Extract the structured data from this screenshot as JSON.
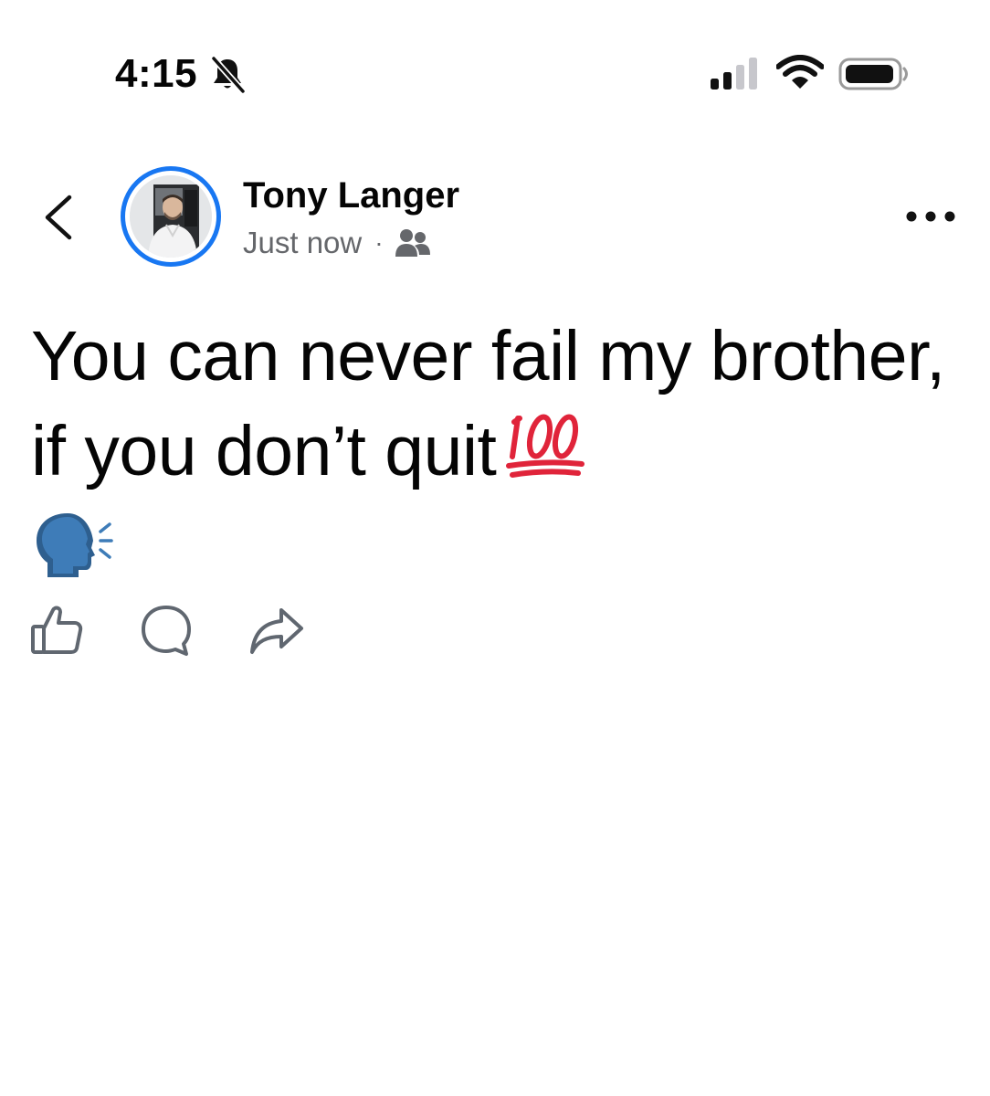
{
  "status_bar": {
    "time": "4:15",
    "icons": [
      "bell-slash-icon",
      "cellular-signal-icon",
      "wifi-icon",
      "battery-icon"
    ]
  },
  "header": {
    "back_icon": "chevron-left-icon",
    "author_name": "Tony Langer",
    "timestamp": "Just now",
    "separator": "·",
    "audience_icon": "friends-icon",
    "more_icon": "more-horizontal-icon",
    "avatar_ring_color": "#1877f2"
  },
  "post": {
    "text": "You can never fail my brother, if you don’t quit",
    "emojis": [
      "hundred-points-emoji",
      "speaking-head-emoji"
    ]
  },
  "actions": {
    "icons": [
      "like-icon",
      "comment-icon",
      "share-icon"
    ]
  },
  "colors": {
    "text_primary": "#050505",
    "text_secondary": "#65676b",
    "accent": "#1877f2",
    "icon_gray": "#606770"
  }
}
